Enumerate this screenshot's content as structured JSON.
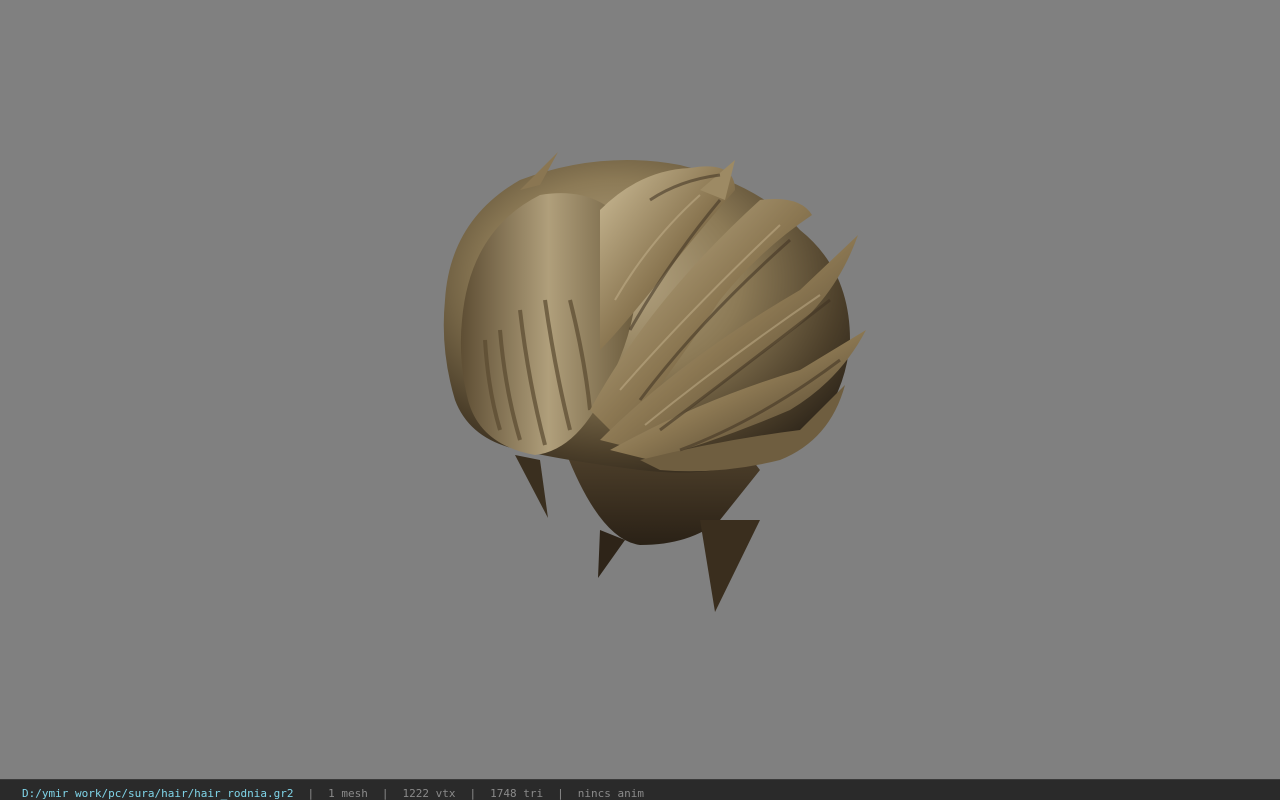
{
  "viewer": {
    "background_color": "#808080",
    "model_icon": "hair-mesh-model"
  },
  "status_bar": {
    "file_path": "D:/ymir work/pc/sura/hair/hair_rodnia.gr2",
    "separator": "|",
    "mesh_count": "1 mesh",
    "vertex_count": "1222 vtx",
    "triangle_count": "1748 tri",
    "animation": "nincs anim",
    "path_color": "#7fd4e8",
    "text_color": "#8a8a8a"
  }
}
